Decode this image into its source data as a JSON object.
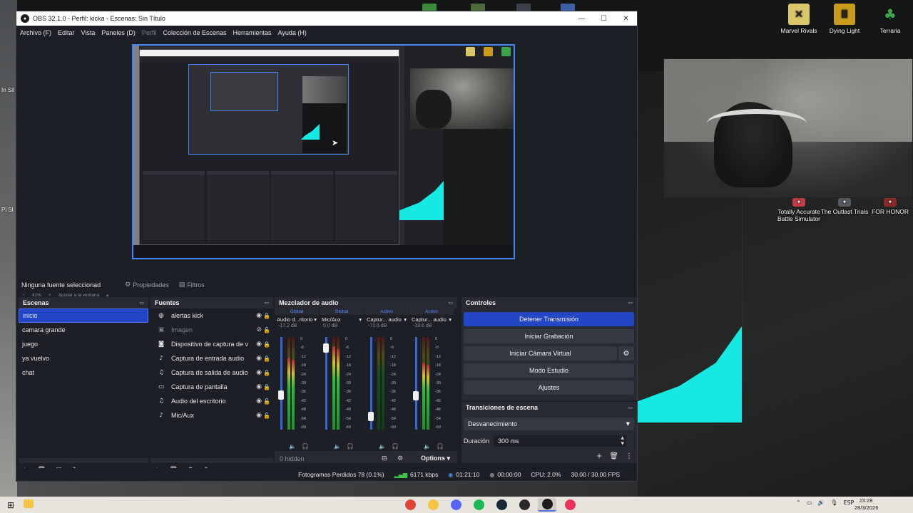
{
  "window": {
    "title": "OBS 32.1.0 - Perfil: kicka - Escenas: Sin Título",
    "minimize": "—",
    "maximize": "☐",
    "close": "✕"
  },
  "menu": [
    "Archivo (F)",
    "Editar",
    "Vista",
    "Paneles (D)",
    "Perfil",
    "Colección de Escenas",
    "Herramientas",
    "Ayuda (H)"
  ],
  "zoom": {
    "percent": "41%",
    "mode": "Ajustar a la ventana"
  },
  "source_toolbar": {
    "no_source": "Ninguna fuente seleccionad",
    "properties": "Propiedades",
    "filters": "Filtros"
  },
  "scenes": {
    "title": "Escenas",
    "items": [
      "inicio",
      "camara grande",
      "juego",
      "ya vuelvo",
      "chat"
    ],
    "active_index": 0
  },
  "sources": {
    "title": "Fuentes",
    "items": [
      {
        "label": "alertas kick",
        "icon": "browser-icon",
        "visible": true,
        "locked": true,
        "dim": false
      },
      {
        "label": "Imagen",
        "icon": "image-icon",
        "visible": false,
        "locked": false,
        "dim": true
      },
      {
        "label": "Dispositivo de captura de v",
        "icon": "camera-icon",
        "visible": true,
        "locked": true,
        "dim": false
      },
      {
        "label": "Captura de entrada audio",
        "icon": "microphone-icon",
        "visible": true,
        "locked": true,
        "dim": false
      },
      {
        "label": "Captura de salida de audio",
        "icon": "speaker-icon",
        "visible": true,
        "locked": true,
        "dim": false
      },
      {
        "label": "Captura de pantalla",
        "icon": "monitor-icon",
        "visible": true,
        "locked": true,
        "dim": false
      },
      {
        "label": "Audio del escritorio",
        "icon": "speaker-icon",
        "visible": true,
        "locked": false,
        "dim": false
      },
      {
        "label": "Mic/Aux",
        "icon": "microphone-icon",
        "visible": true,
        "locked": false,
        "dim": false
      }
    ]
  },
  "mixer": {
    "title": "Mezclador de audio",
    "channels": [
      {
        "tag": "Global",
        "name": "Audio d...ritorio",
        "db": "-17.2 dB",
        "level": 0.78,
        "fader": 0.36,
        "meter_on": true
      },
      {
        "tag": "Global",
        "name": "Mic/Aux",
        "db": "0.0 dB",
        "level": 0.9,
        "fader": 0.92,
        "meter_on": true
      },
      {
        "tag": "Activo",
        "name": "Captur... audio",
        "db": "-71.6 dB",
        "level": 0.0,
        "fader": 0.1,
        "meter_on": false
      },
      {
        "tag": "Activo",
        "name": "Captur... audio",
        "db": "-19.6 dB",
        "level": 0.72,
        "fader": 0.35,
        "meter_on": true
      }
    ],
    "scale": [
      "0",
      "-6",
      "-12",
      "-18",
      "-24",
      "-30",
      "-36",
      "-42",
      "-48",
      "-54",
      "-60"
    ],
    "hidden": "0 hidden",
    "options": "Options"
  },
  "controls": {
    "title": "Controles",
    "stop_stream": "Detener Transmisión",
    "start_recording": "Iniciar Grabación",
    "virtual_camera": "Iniciar Cámara Virtual",
    "studio_mode": "Modo Estudio",
    "settings": "Ajustes"
  },
  "transitions": {
    "title": "Transiciones de escena",
    "selected": "Desvanecimiento",
    "duration_label": "Duración",
    "duration_value": "300 ms"
  },
  "status": {
    "dropped": "Fotogramas Perdidos 78 (0.1%)",
    "bitrate": "6171 kbps",
    "live_time": "01:21:10",
    "rec_time": "00:00:00",
    "cpu": "CPU: 2.0%",
    "fps": "30.00 / 30.00 FPS"
  },
  "desktop_icons": [
    {
      "label": "Marvel Rivals",
      "color": "#d9c76a"
    },
    {
      "label": "Dying Light",
      "color": "#c99b1c"
    },
    {
      "label": "Terraria",
      "color": "#3fa34d"
    }
  ],
  "desktop_icons_row2": [
    {
      "label": "Totally Accurate Battle Simulator",
      "color": "#c03a48"
    },
    {
      "label": "The Outlast Trials",
      "color": "#555a60"
    },
    {
      "label": "FOR HONOR",
      "color": "#8a2a2a"
    }
  ],
  "left_clipped_labels": [
    "In Sil",
    "Pl Sl"
  ],
  "taskbar": {
    "apps": [
      {
        "name": "chrome-icon",
        "color": "#e0453a"
      },
      {
        "name": "file-explorer-icon",
        "color": "#f6c443"
      },
      {
        "name": "discord-icon",
        "color": "#5865f2"
      },
      {
        "name": "spotify-icon",
        "color": "#1db954"
      },
      {
        "name": "steam-icon",
        "color": "#1b2838"
      },
      {
        "name": "app-icon",
        "color": "#2a2a2a"
      },
      {
        "name": "obs-icon",
        "color": "#1c1c1c"
      },
      {
        "name": "tiktok-icon",
        "color": "#e8345a"
      }
    ],
    "lang": "ESP",
    "time": "23:28",
    "date": "28/3/2026"
  }
}
